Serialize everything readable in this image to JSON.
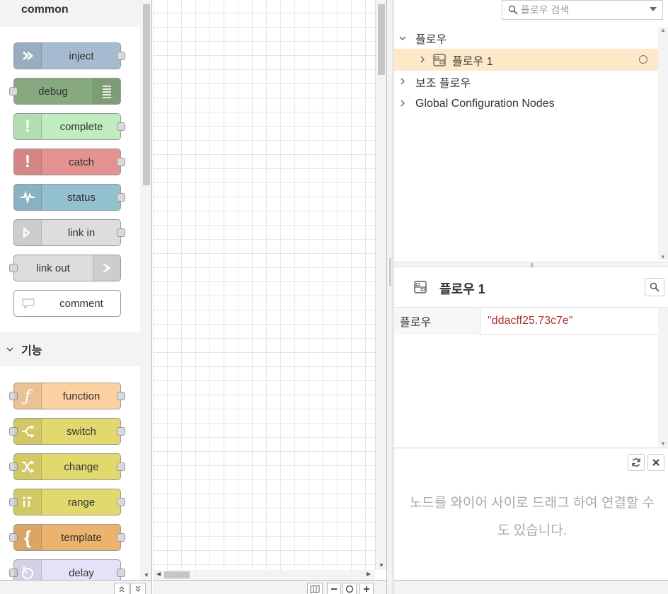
{
  "palette": {
    "common_header": "common",
    "common_nodes": [
      {
        "label": "inject",
        "color": "#a6bbcf",
        "icon": "arrow-right-icon"
      },
      {
        "label": "debug",
        "color": "#87a980",
        "icon": "list-icon"
      },
      {
        "label": "complete",
        "color": "#c0edc0",
        "icon": "exclamation-icon"
      },
      {
        "label": "catch",
        "color": "#e49191",
        "icon": "exclamation-icon"
      },
      {
        "label": "status",
        "color": "#94c1d0",
        "icon": "pulse-icon"
      },
      {
        "label": "link in",
        "color": "#dddddd",
        "icon": "link-in-icon"
      },
      {
        "label": "link out",
        "color": "#dddddd",
        "icon": "link-out-icon"
      },
      {
        "label": "comment",
        "color": "#ffffff",
        "icon": "comment-icon"
      }
    ],
    "function_header": "기능",
    "function_nodes": [
      {
        "label": "function",
        "color": "#fdd0a2",
        "icon": "function-icon"
      },
      {
        "label": "switch",
        "color": "#e2d96e",
        "icon": "switch-icon"
      },
      {
        "label": "change",
        "color": "#e2d96e",
        "icon": "shuffle-icon"
      },
      {
        "label": "range",
        "color": "#e2d96e",
        "icon": "range-icon"
      },
      {
        "label": "template",
        "color": "#ebb36e",
        "icon": "brace-icon"
      },
      {
        "label": "delay",
        "color": "#e6e0f8",
        "icon": "timer-icon"
      }
    ]
  },
  "sidebar": {
    "search_placeholder": "플로우 검색",
    "tree": {
      "flows_label": "플로우",
      "flow1_label": "플로우 1",
      "subflows_label": "보조 플로우",
      "config_label": "Global Configuration Nodes"
    },
    "info": {
      "title": "플로우 1",
      "key": "플로우",
      "value": "\"ddacff25.73c7e\""
    },
    "tip": "노드를 와이어 사이로 드래그 하여 연결할 수도 있습니다."
  },
  "colors": {
    "selected_row": "#fde9c8",
    "grid_line": "#e6e6e6",
    "value_text": "#aa3333"
  }
}
